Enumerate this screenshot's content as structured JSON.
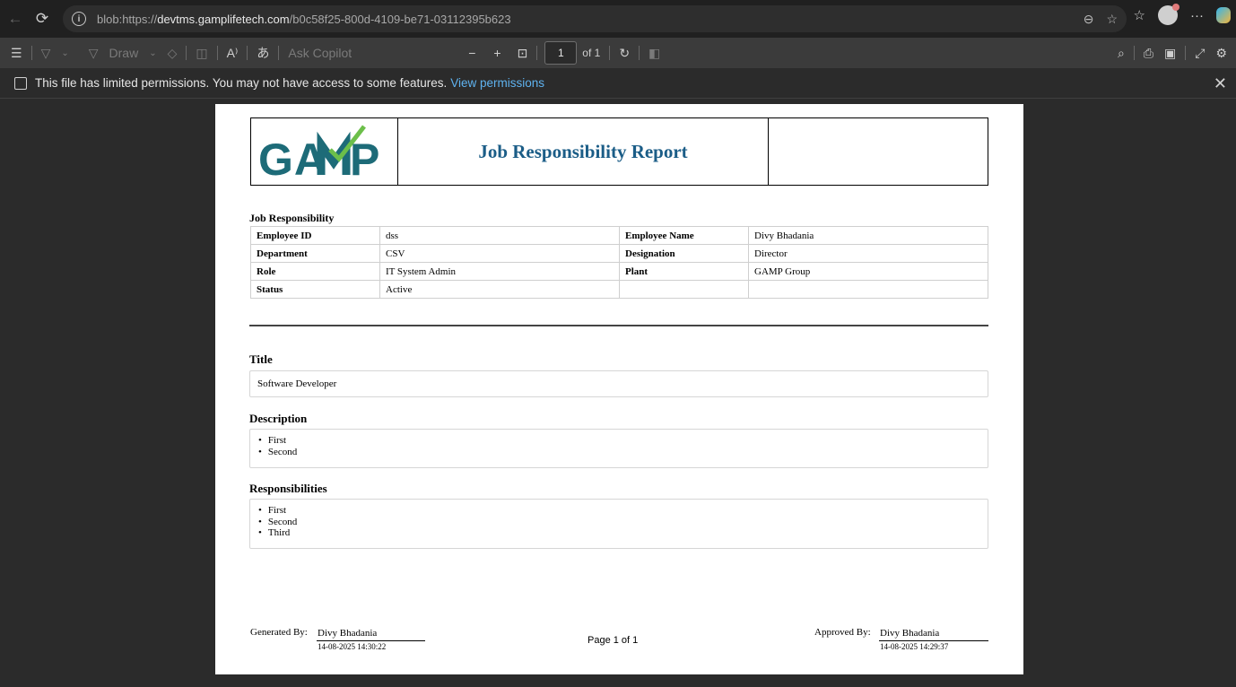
{
  "browser": {
    "url_prefix": "blob:https://",
    "url_domain": "devtms.gamplifetech.com",
    "url_path": "/b0c58f25-800d-4109-be71-03112395b623"
  },
  "pdf_toolbar": {
    "draw_label": "Draw",
    "ask_copilot_label": "Ask Copilot",
    "current_page": "1",
    "page_total": "of 1"
  },
  "permission_bar": {
    "message": "This file has limited permissions. You may not have access to some features.",
    "link": "View permissions"
  },
  "report": {
    "logo_text": "GAMP",
    "title": "Job Responsibility Report",
    "section_label": "Job Responsibility",
    "rows": [
      {
        "k1": "Employee ID",
        "v1": "dss",
        "k2": "Employee Name",
        "v2": "Divy Bhadania"
      },
      {
        "k1": "Department",
        "v1": "CSV",
        "k2": "Designation",
        "v2": "Director"
      },
      {
        "k1": "Role",
        "v1": "IT System Admin",
        "k2": "Plant",
        "v2": "GAMP Group"
      },
      {
        "k1": "Status",
        "v1": "Active",
        "k2": "",
        "v2": ""
      }
    ],
    "title_heading": "Title",
    "title_value": "Software Developer",
    "description_heading": "Description",
    "description_items": [
      "First",
      "Second"
    ],
    "responsibilities_heading": "Responsibilities",
    "responsibilities_items": [
      "First",
      "Second",
      "Third"
    ],
    "footer": {
      "generated_by_label": "Generated By:",
      "generated_by_name": "Divy Bhadania",
      "generated_date": "14-08-2025 14:30:22",
      "page_label": "Page 1 of 1",
      "approved_by_label": "Approved By:",
      "approved_by_name": "Divy Bhadania",
      "approved_date": "14-08-2025 14:29:37"
    }
  },
  "colors": {
    "title_blue": "#1b5d87",
    "logo_teal": "#1d6b78",
    "logo_green": "#6cbf4a",
    "link_blue": "#5fb3f0"
  }
}
